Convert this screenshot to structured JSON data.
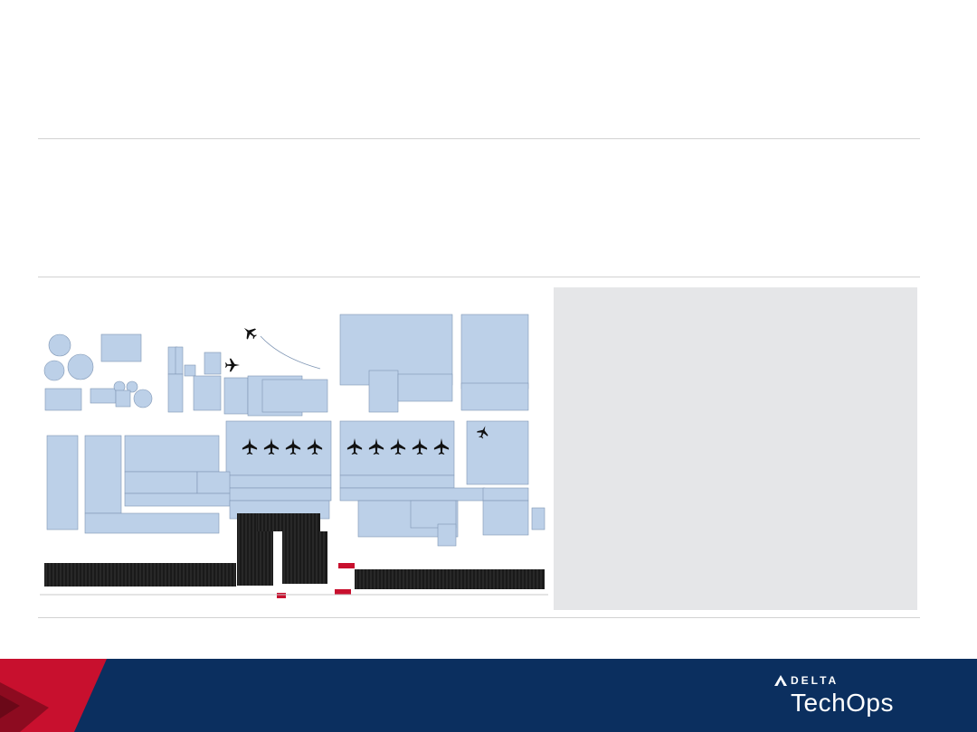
{
  "slide": {
    "background": "#ffffff",
    "rule_color": "#d2d2d2"
  },
  "diagram": {
    "kind": "hangar-floor-plan",
    "fill_color": "#bcd0e8",
    "stroke_color": "#7f96b4",
    "aircraft_icon": "airplane-icon",
    "hatch_color": "#1a1a1a"
  },
  "side_panel": {
    "background": "#e5e6e8"
  },
  "footer": {
    "background": "#0b2f5f",
    "accent_red": "#c8102e",
    "accent_red_dark": "#8d0b20",
    "logo_icon": "delta-widget-icon",
    "brand_top": "DELTA",
    "brand_bottom": "TechOps"
  }
}
